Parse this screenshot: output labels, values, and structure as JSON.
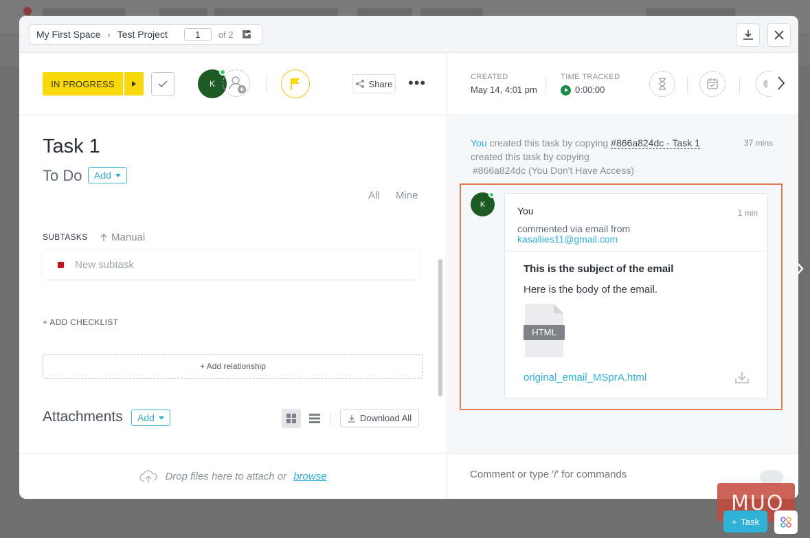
{
  "header": {
    "breadcrumb": {
      "space": "My First Space",
      "project": "Test Project"
    },
    "page_current": "1",
    "page_total": "of 2"
  },
  "toolbar": {
    "status": "IN PROGRESS",
    "assignee_initial": "K",
    "share_label": "Share",
    "more_label": "•••"
  },
  "task": {
    "title": "Task 1",
    "status_group": "To Do",
    "add_label": "Add",
    "filters": [
      "All",
      "Mine"
    ],
    "subtasks_label": "SUBTASKS",
    "sort_label": "Manual",
    "new_subtask_placeholder": "New subtask",
    "add_checklist": "+ ADD CHECKLIST",
    "add_relationship": "+ Add relationship",
    "attachments_title": "Attachments",
    "attachments_add": "Add",
    "download_all": "Download All"
  },
  "meta": {
    "created_label": "CREATED",
    "created_value": "May 14, 4:01 pm",
    "tracked_label": "TIME TRACKED",
    "tracked_value": "0:00:00"
  },
  "activity": {
    "actor": "You",
    "text1": "created this task by copying",
    "task_ref": "#866a824dc - Task 1",
    "text2": "created this task by copying",
    "text3": "#866a824dc (You Don't Have Access)",
    "time": "37 mins"
  },
  "comment": {
    "avatar_initial": "K",
    "author": "You",
    "time": "1 min",
    "via": "commented via email from",
    "email": "kasallies11@gmail.com",
    "subject": "This is the subject of the email",
    "body": "Here is the body of the email.",
    "file_type": "HTML",
    "file_name": "original_email_MSprA.html"
  },
  "footer": {
    "drop_text": "Drop files here to attach or",
    "browse": "browse",
    "comment_placeholder": "Comment or type '/' for commands"
  },
  "overlay": {
    "watermark": "MUO",
    "task_fab": "Task"
  },
  "colors": {
    "status": "#f9d90c",
    "accent": "#2fb2d6",
    "avatar": "#1e5b24",
    "highlight": "#e07a52"
  }
}
